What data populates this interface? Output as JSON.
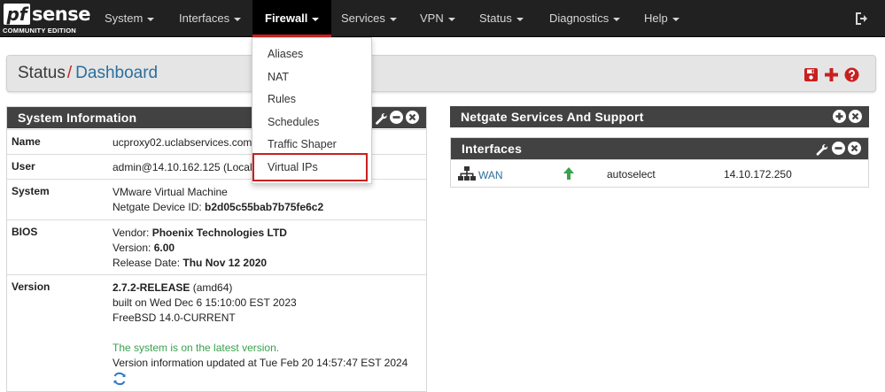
{
  "logo": {
    "brand_left": "pf",
    "brand_right": "sense",
    "edition": "COMMUNITY EDITION"
  },
  "nav": {
    "items": [
      {
        "label": "System"
      },
      {
        "label": "Interfaces"
      },
      {
        "label": "Firewall"
      },
      {
        "label": "Services"
      },
      {
        "label": "VPN"
      },
      {
        "label": "Status"
      },
      {
        "label": "Diagnostics"
      },
      {
        "label": "Help"
      }
    ],
    "active": "Firewall"
  },
  "breadcrumb": {
    "section": "Status",
    "separator": "/",
    "page": "Dashboard"
  },
  "firewall_menu": {
    "items": [
      {
        "label": "Aliases"
      },
      {
        "label": "NAT"
      },
      {
        "label": "Rules"
      },
      {
        "label": "Schedules"
      },
      {
        "label": "Traffic Shaper"
      },
      {
        "label": "Virtual IPs"
      }
    ],
    "highlighted": "Virtual IPs"
  },
  "system_info": {
    "title": "System Information",
    "name": {
      "label": "Name",
      "value": "ucproxy02.uclabservices.com"
    },
    "user": {
      "label": "User",
      "value": "admin@14.10.162.125 (Local"
    },
    "system": {
      "label": "System",
      "line1": "VMware Virtual Machine",
      "line2_prefix": "Netgate Device ID: ",
      "device_id": "b2d05c55bab7b75fe6c2"
    },
    "bios": {
      "label": "BIOS",
      "vendor_prefix": "Vendor: ",
      "vendor": "Phoenix Technologies LTD",
      "version_prefix": "Version: ",
      "version": "6.00",
      "release_prefix": "Release Date: ",
      "release": "Thu Nov 12 2020"
    },
    "version": {
      "label": "Version",
      "release": "2.7.2-RELEASE",
      "arch": " (amd64)",
      "built": "built on Wed Dec 6 15:10:00 EST 2023",
      "os": "FreeBSD 14.0-CURRENT",
      "status": "The system is on the latest version.",
      "updated": "Version information updated at Tue Feb 20 14:57:47 EST 2024"
    }
  },
  "netgate_panel": {
    "title": "Netgate Services And Support"
  },
  "interfaces_panel": {
    "title": "Interfaces",
    "rows": [
      {
        "name": "WAN",
        "status": "up",
        "media": "autoselect",
        "ip": "14.10.172.250"
      }
    ]
  },
  "colors": {
    "navbar": "#212121",
    "accent_red": "#c8201f",
    "link_blue": "#2b6f9e",
    "panel_head": "#424242",
    "ok_green": "#3aa14d"
  }
}
